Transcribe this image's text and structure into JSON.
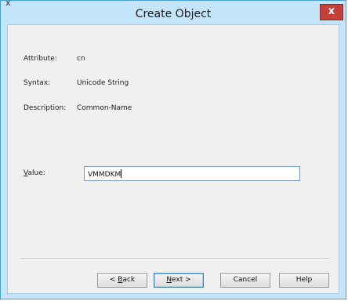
{
  "window": {
    "title": "Create Object",
    "close_label": "x",
    "corner_glyph": "x"
  },
  "fields": {
    "attribute": {
      "label": "Attribute:",
      "value": "cn"
    },
    "syntax": {
      "label": "Syntax:",
      "value": "Unicode String"
    },
    "description": {
      "label": "Description:",
      "value": "Common-Name"
    },
    "value": {
      "label_mnemonic": "V",
      "label_rest": "alue:",
      "input_value": "VMMDKM"
    }
  },
  "buttons": {
    "back": {
      "prefix": "< ",
      "mnemonic": "B",
      "rest": "ack"
    },
    "next": {
      "mnemonic": "N",
      "rest": "ext >"
    },
    "cancel": "Cancel",
    "help": "Help"
  },
  "colors": {
    "frame": "#c3e4f9",
    "client": "#f0f0f0",
    "close_button": "#c4403a"
  }
}
